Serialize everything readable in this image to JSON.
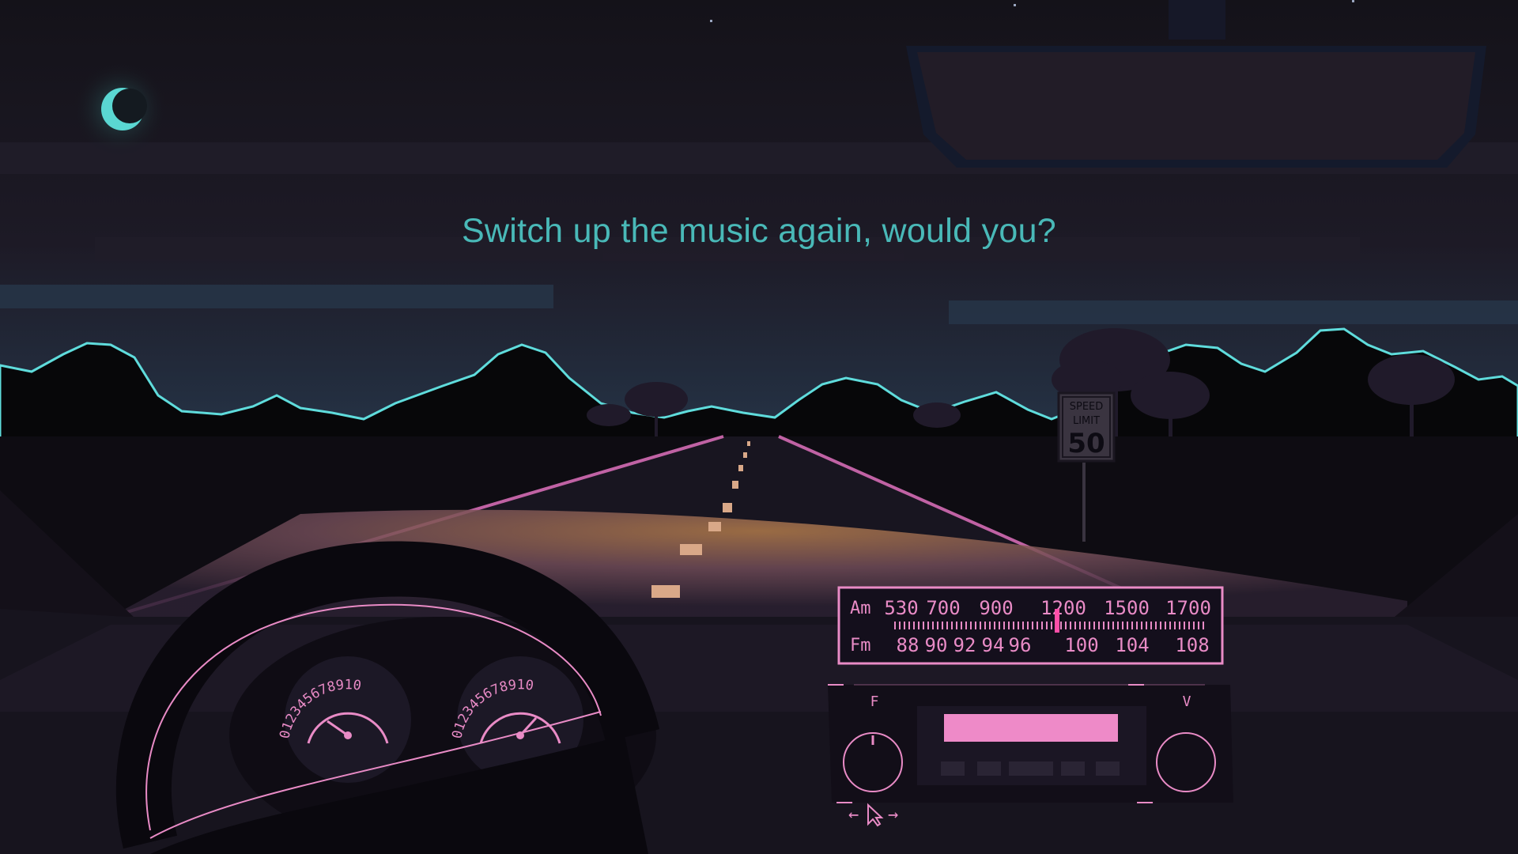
{
  "dialogue": {
    "text": "Switch up the music again, would you?"
  },
  "speed_limit_sign": {
    "line1": "SPEED",
    "line2": "LIMIT",
    "value": "50"
  },
  "radio_dial": {
    "am_label": "Am",
    "fm_label": "Fm",
    "am_stations": [
      "530",
      "700",
      "900",
      "1200",
      "1500",
      "1700"
    ],
    "fm_stations": [
      "88",
      "90",
      "92",
      "94",
      "96",
      "100",
      "104",
      "108"
    ]
  },
  "radio_controls": {
    "left_knob_label": "F",
    "right_knob_label": "V",
    "display_color": "#ee8ac8"
  },
  "gauges": {
    "left_numbers": "012345678910",
    "right_numbers": "012345678910"
  },
  "nav_hint": {
    "left_arrow": "←",
    "right_arrow": "→"
  },
  "colors": {
    "accent_pink": "#e98bc6",
    "accent_teal": "#49b9b8",
    "sky": "#1a1822",
    "ridge_glow": "#5fdcdc"
  }
}
